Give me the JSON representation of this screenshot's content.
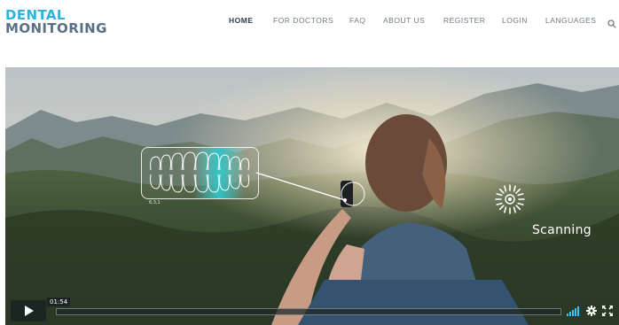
{
  "logo": {
    "line1": "DENTAL",
    "line2": "MONITORING",
    "trademark": "®"
  },
  "nav": {
    "items": [
      {
        "label": "HOME",
        "active": true
      },
      {
        "label": "FOR DOCTORS",
        "active": false
      },
      {
        "label": "FAQ",
        "active": false
      },
      {
        "label": "ABOUT US",
        "active": false
      },
      {
        "label": "REGISTER",
        "active": false
      },
      {
        "label": "LOGIN",
        "active": false
      },
      {
        "label": "LANGUAGES",
        "active": false
      }
    ],
    "search_icon": "search-icon"
  },
  "video": {
    "overlay": {
      "scanning_label": "Scanning",
      "teeth_caption": "6,3,1"
    },
    "controls": {
      "time": "01:54",
      "progress": 0.0,
      "icons": [
        "play-icon",
        "volume-icon",
        "gear-icon",
        "fullscreen-icon"
      ]
    }
  },
  "colors": {
    "brand_blue": "#2ab4e3",
    "brand_gray": "#5b6f82",
    "nav_text": "#6e7a86",
    "nav_active": "#2c3e50"
  }
}
